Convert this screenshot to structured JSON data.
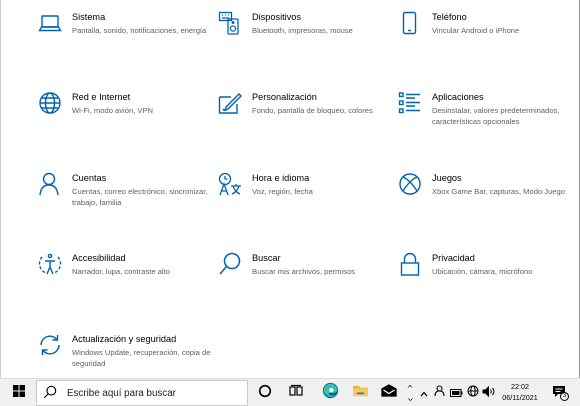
{
  "settings": {
    "tiles": [
      {
        "title": "Sistema",
        "desc": "Pantalla, sonido, notificaciones, energía",
        "icon": "laptop-icon"
      },
      {
        "title": "Dispositivos",
        "desc": "Bluetooth, impresoras, mouse",
        "icon": "keyboard-devices-icon"
      },
      {
        "title": "Teléfono",
        "desc": "Vincular Android o iPhone",
        "icon": "phone-icon"
      },
      {
        "title": "Red e Internet",
        "desc": "Wi-Fi, modo avión, VPN",
        "icon": "globe-icon"
      },
      {
        "title": "Personalización",
        "desc": "Fondo, pantalla de bloqueo, colores",
        "icon": "paint-pen-icon"
      },
      {
        "title": "Aplicaciones",
        "desc": "Desinstalar, valores predeterminados, características opcionales",
        "icon": "apps-list-icon"
      },
      {
        "title": "Cuentas",
        "desc": "Cuentas, correo electrónico, sincronizar, trabajo, familia",
        "icon": "person-icon"
      },
      {
        "title": "Hora e idioma",
        "desc": "Voz, región, fecha",
        "icon": "time-language-icon"
      },
      {
        "title": "Juegos",
        "desc": "Xbox Game Bar, capturas, Modo Juego",
        "icon": "xbox-icon"
      },
      {
        "title": "Accesibilidad",
        "desc": "Narrador, lupa, contraste alto",
        "icon": "accessibility-icon"
      },
      {
        "title": "Buscar",
        "desc": "Buscar mis archivos, permisos",
        "icon": "search-icon"
      },
      {
        "title": "Privacidad",
        "desc": "Ubicación, cámara, micrófono",
        "icon": "lock-icon"
      },
      {
        "title": "Actualización y seguridad",
        "desc": "Windows Update, recuperación, copia de seguridad",
        "icon": "update-sync-icon"
      }
    ],
    "accent_color": "#0063b1"
  },
  "taskbar": {
    "search_placeholder": "Escribe aquí para buscar",
    "time": "22:02",
    "date": "06/11/2021",
    "notification_count": "3"
  }
}
